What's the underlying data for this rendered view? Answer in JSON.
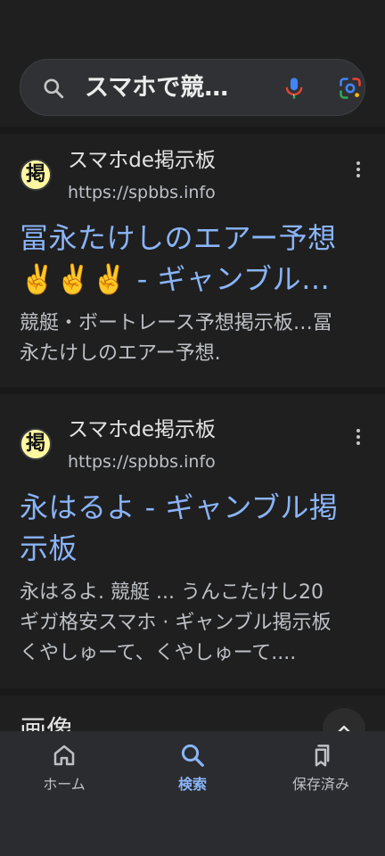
{
  "search": {
    "query": "スマホで競…"
  },
  "results": [
    {
      "favicon_char": "掲",
      "site_name": "スマホde掲示板",
      "url": "https://spbbs.info",
      "title_line1": "冨永たけしのエアー予想",
      "title_line2": "✌️✌️✌️ - ギャンブル…",
      "snippet_line1": "競艇・ボートレース予想掲示板…冨",
      "snippet_line2": "永たけしのエアー予想."
    },
    {
      "favicon_char": "掲",
      "site_name": "スマホde掲示板",
      "url": "https://spbbs.info",
      "title_line1": "永はるよ - ギャンブル掲",
      "title_line2": "示板",
      "snippet_line1": "永はるよ. 競艇 ... うんこたけし20",
      "snippet_line2": "ギガ格安スマホ · ギャンブル掲示板",
      "snippet_line3": "くやしゅーて、くやしゅーて...."
    }
  ],
  "images_section": {
    "heading": "画像"
  },
  "bottom_nav": {
    "items": [
      {
        "label": "ホーム",
        "icon": "home-icon"
      },
      {
        "label": "検索",
        "icon": "search-icon"
      },
      {
        "label": "保存済み",
        "icon": "saved-icon"
      }
    ]
  },
  "colors": {
    "background": "#1f1f1f",
    "link": "#8ab4f8",
    "snippet": "#bdc1c6",
    "active_nav": "#8ab4f8",
    "nav_bar": "#2b2c2f"
  }
}
